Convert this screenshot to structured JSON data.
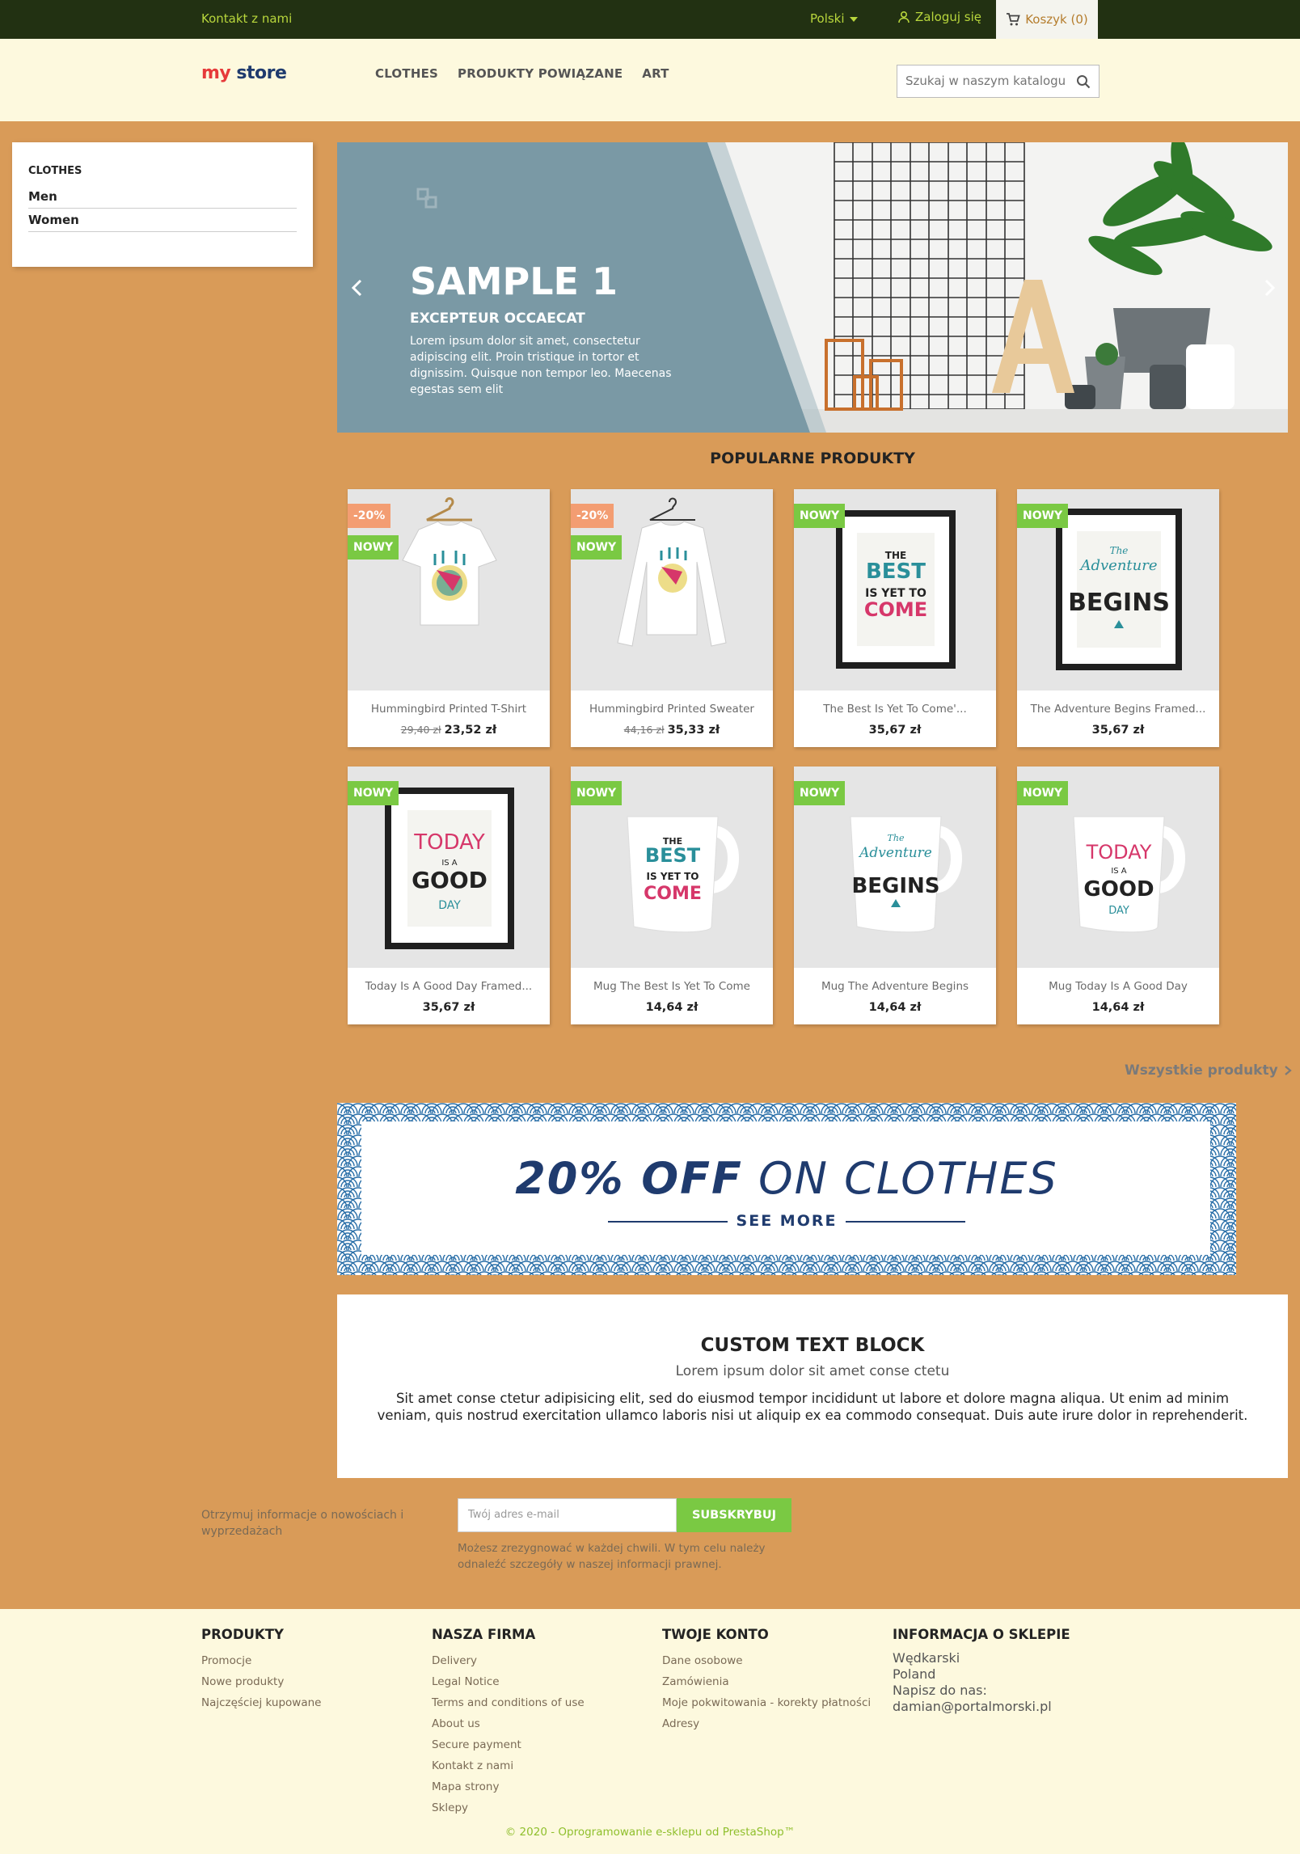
{
  "topbar": {
    "contact": "Kontakt z nami",
    "language": "Polski",
    "login": "Zaloguj się",
    "cart": "Koszyk (0)"
  },
  "header": {
    "logo": {
      "part1": "my",
      "part2": " store"
    },
    "nav": [
      "CLOTHES",
      "PRODUKTY POWIĄZANE",
      "ART"
    ],
    "search_placeholder": "Szukaj w naszym katalogu"
  },
  "sidebar": {
    "title": "CLOTHES",
    "items": [
      "Men",
      "Women"
    ]
  },
  "slider": {
    "title": "SAMPLE 1",
    "subtitle": "EXCEPTEUR OCCAECAT",
    "description": "Lorem ipsum dolor sit amet, consectetur adipiscing elit. Proin tristique in tortor et dignissim. Quisque non tempor leo. Maecenas egestas sem elit"
  },
  "popular": {
    "title": "POPULARNE PRODUKTY",
    "products": [
      {
        "name": "Hummingbird Printed T-Shirt",
        "old_price": "29,40 zł",
        "price": "23,52 zł",
        "discount": "-20%",
        "badge": "NOWY"
      },
      {
        "name": "Hummingbird Printed Sweater",
        "old_price": "44,16 zł",
        "price": "35,33 zł",
        "discount": "-20%",
        "badge": "NOWY"
      },
      {
        "name": "The Best Is Yet To Come'...",
        "price": "35,67 zł",
        "badge": "NOWY"
      },
      {
        "name": "The Adventure Begins Framed...",
        "price": "35,67 zł",
        "badge": "NOWY"
      },
      {
        "name": "Today Is A Good Day Framed...",
        "price": "35,67 zł",
        "badge": "NOWY"
      },
      {
        "name": "Mug The Best Is Yet To Come",
        "price": "14,64 zł",
        "badge": "NOWY"
      },
      {
        "name": "Mug The Adventure Begins",
        "price": "14,64 zł",
        "badge": "NOWY"
      },
      {
        "name": "Mug Today Is A Good Day",
        "price": "14,64 zł",
        "badge": "NOWY"
      }
    ],
    "all_link": "Wszystkie produkty"
  },
  "promo": {
    "bold": "20% OFF",
    "rest": " ON CLOTHES",
    "cta": "SEE MORE"
  },
  "custom_block": {
    "title": "CUSTOM TEXT BLOCK",
    "lead": "Lorem ipsum dolor sit amet conse ctetu",
    "body": "Sit amet conse ctetur adipisicing elit, sed do eiusmod tempor incididunt ut labore et dolore magna aliqua. Ut enim ad minim veniam, quis nostrud exercitation ullamco laboris nisi ut aliquip ex ea commodo consequat. Duis aute irure dolor in reprehenderit."
  },
  "newsletter": {
    "label": "Otrzymuj informacje o nowościach i wyprzedażach",
    "placeholder": "Twój adres e-mail",
    "button": "SUBSKRYBUJ",
    "note": "Możesz zrezygnować w każdej chwili. W tym celu należy odnaleźć szczegóły w naszej informacji prawnej."
  },
  "footer": {
    "products": {
      "title": "PRODUKTY",
      "links": [
        "Promocje",
        "Nowe produkty",
        "Najczęściej kupowane"
      ]
    },
    "company": {
      "title": "NASZA FIRMA",
      "links": [
        "Delivery",
        "Legal Notice",
        "Terms and conditions of use",
        "About us",
        "Secure payment",
        "Kontakt z nami",
        "Mapa strony",
        "Sklepy"
      ]
    },
    "account": {
      "title": "TWOJE KONTO",
      "links": [
        "Dane osobowe",
        "Zamówienia",
        "Moje pokwitowania - korekty płatności",
        "Adresy"
      ]
    },
    "store_info": {
      "title": "INFORMACJA O SKLEPIE",
      "line1": "Wędkarski",
      "line2": "Poland",
      "line3": "Napisz do nas:",
      "email": "damian@portalmorski.pl"
    },
    "copyright": "© 2020 - Oprogramowanie e-sklepu od PrestaShop™"
  },
  "colors": {
    "page_bg": "#d99b58",
    "topbar_bg": "#223112",
    "header_bg": "#fdf9de",
    "accent_green": "#7ac943",
    "discount": "#f39d72",
    "promo_navy": "#1f3b6e"
  }
}
